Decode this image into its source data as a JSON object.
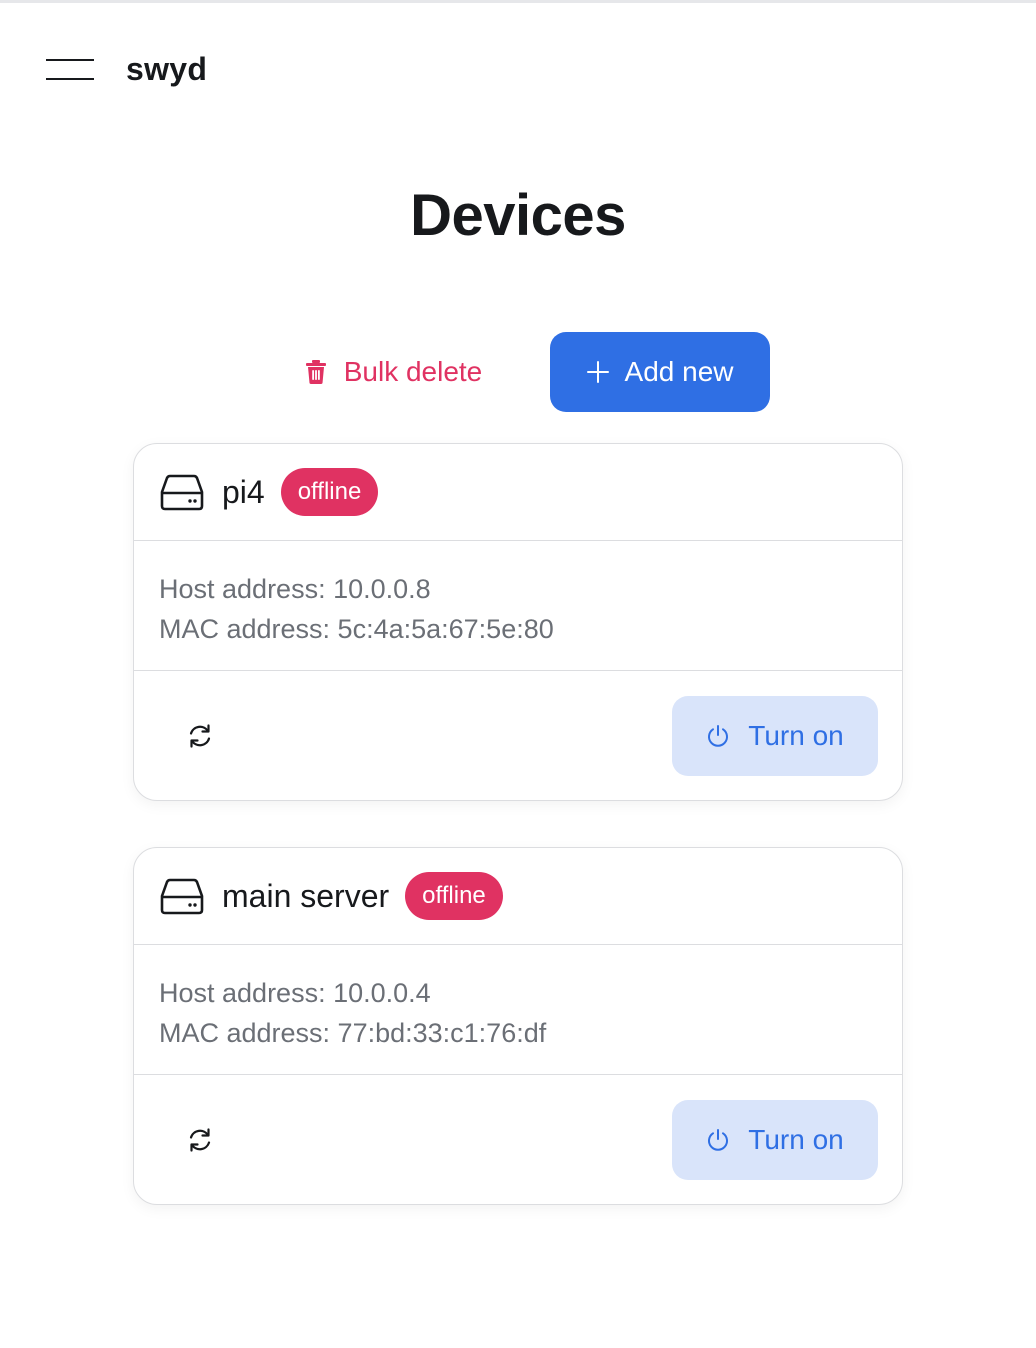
{
  "header": {
    "brand": "swyd",
    "menu_icon": "hamburger-menu-icon"
  },
  "page": {
    "title": "Devices"
  },
  "toolbar": {
    "bulk_delete_label": "Bulk delete",
    "bulk_delete_icon": "trash-icon",
    "add_new_label": "Add new",
    "add_new_icon": "plus-icon"
  },
  "devices": [
    {
      "name": "pi4",
      "status": "offline",
      "host_address": "Host address: 10.0.0.8",
      "mac_address": "MAC address: 5c:4a:5a:67:5e:80",
      "action_label": "Turn on",
      "icon": "hard-drive-icon"
    },
    {
      "name": "main server",
      "status": "offline",
      "host_address": "Host address: 10.0.0.4",
      "mac_address": "MAC address: 77:bd:33:c1:76:df",
      "action_label": "Turn on",
      "icon": "hard-drive-icon"
    }
  ],
  "colors": {
    "primary": "#2f6fe4",
    "primary_light": "#d9e4fa",
    "danger": "#e03262",
    "text": "#17191c",
    "muted": "#6b6f76",
    "border": "#dcdde0"
  }
}
